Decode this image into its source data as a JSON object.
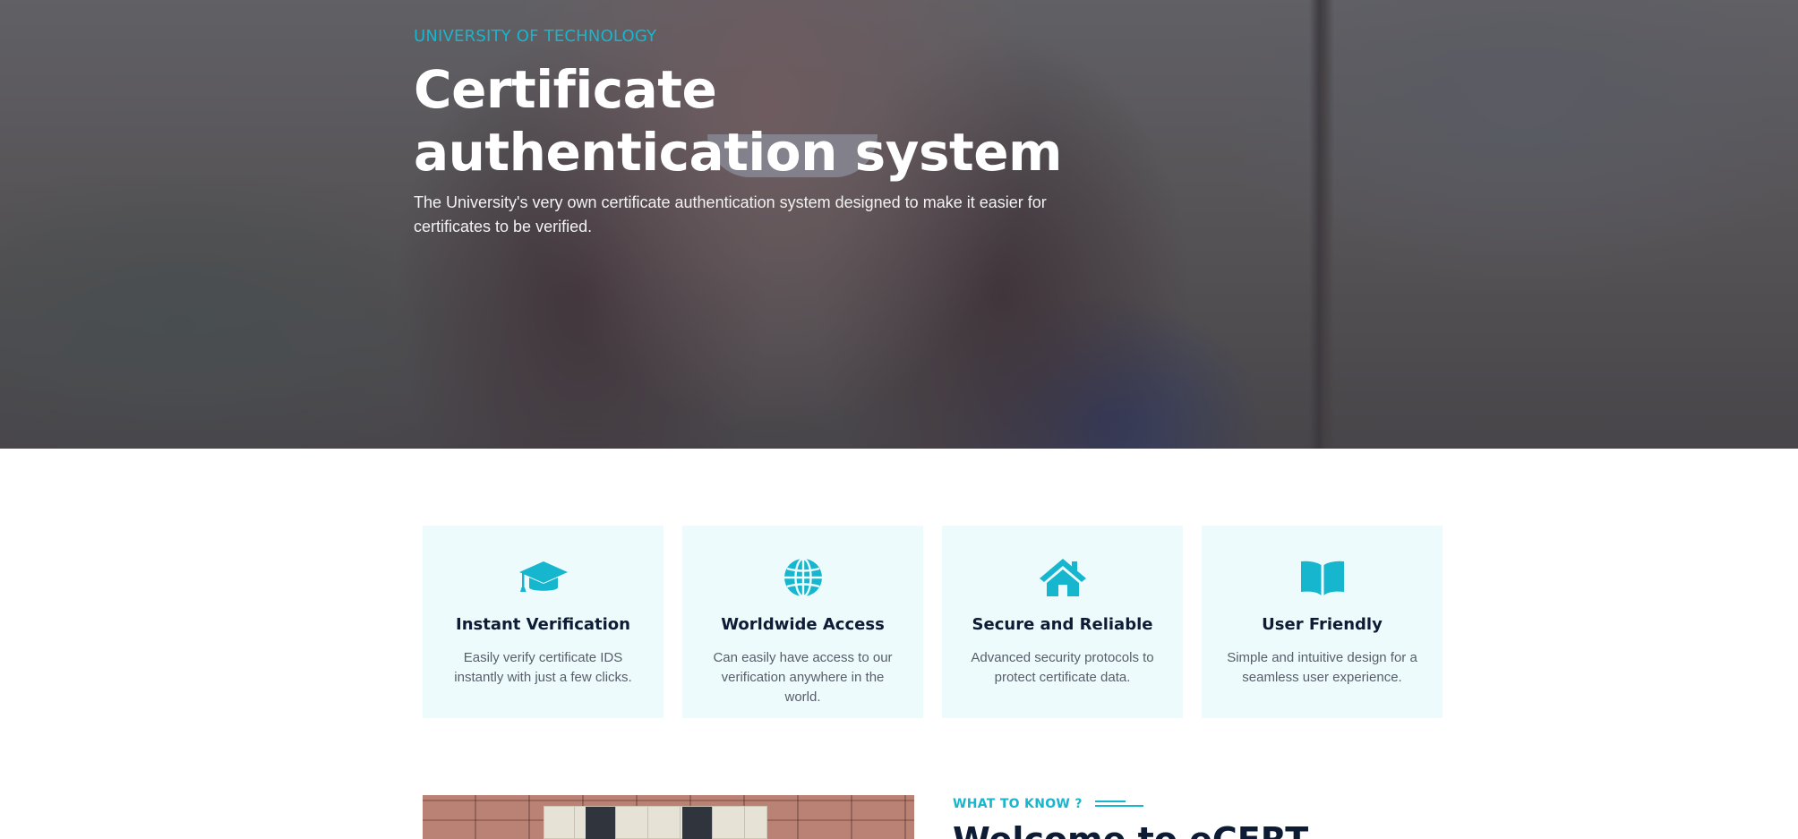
{
  "hero": {
    "kicker": "UNIVERSITY OF TECHNOLOGY",
    "title": "Certificate authentication system",
    "description": "The University's very own certificate authentication system designed to make it easier for certificates to be verified."
  },
  "features": [
    {
      "icon": "graduation-cap-icon",
      "title": "Instant Verification",
      "text": "Easily verify certificate IDS instantly with just a few clicks."
    },
    {
      "icon": "globe-icon",
      "title": "Worldwide Access",
      "text": "Can easily have access to our verification anywhere in the world."
    },
    {
      "icon": "home-icon",
      "title": "Secure and Reliable",
      "text": "Advanced security protocols to protect certificate data."
    },
    {
      "icon": "book-open-icon",
      "title": "User Friendly",
      "text": "Simple and intuitive design for a seamless user experience."
    }
  ],
  "about": {
    "kicker": "WHAT TO KNOW ?",
    "heading": "Welcome to eCERT"
  },
  "colors": {
    "accent": "#17b6cf",
    "heading": "#0d1b34",
    "card_background": "#eefbfc",
    "body_text": "#575e6a"
  }
}
